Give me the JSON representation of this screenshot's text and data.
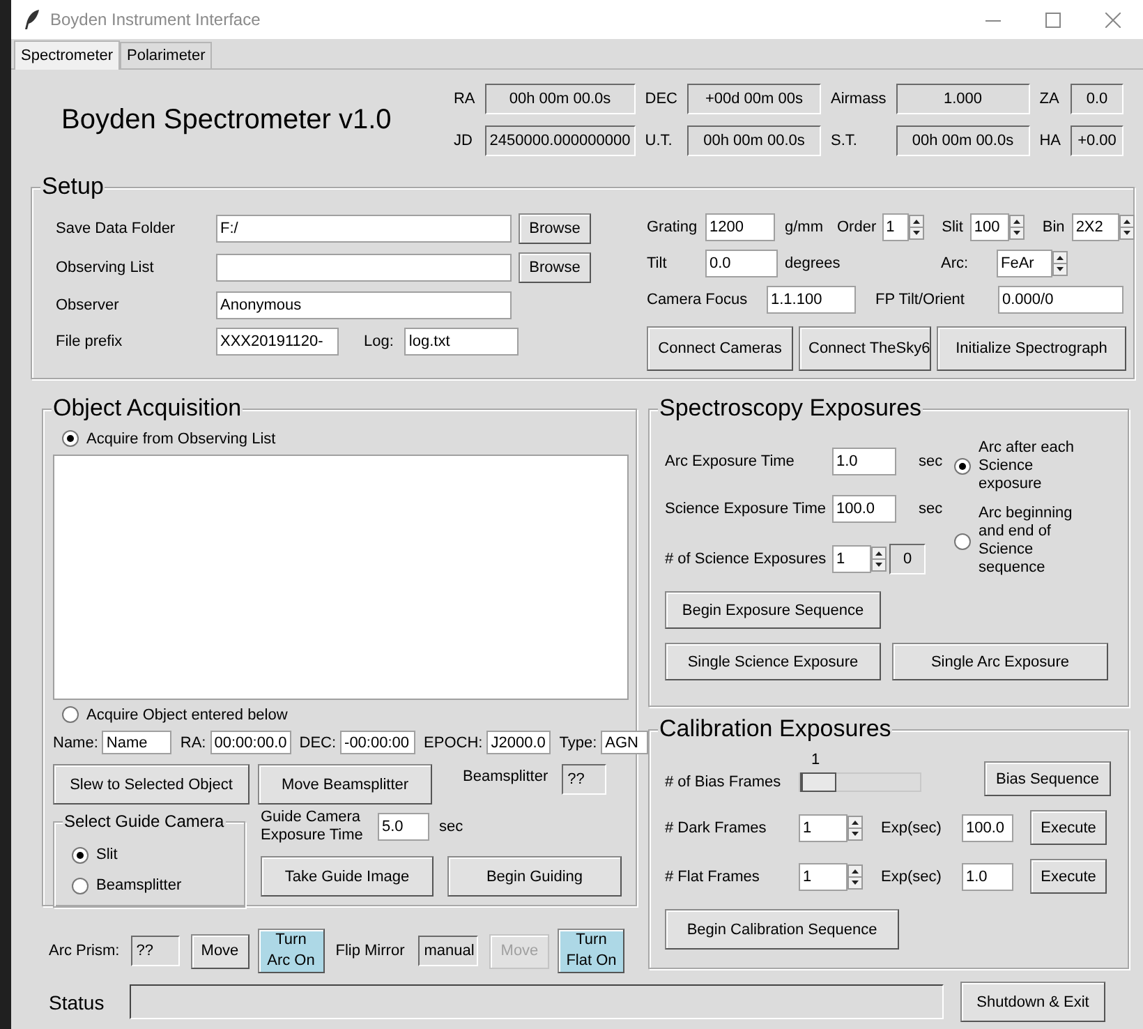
{
  "window": {
    "title": "Boyden Instrument Interface"
  },
  "tabs": [
    {
      "label": "Spectrometer",
      "selected": true
    },
    {
      "label": "Polarimeter",
      "selected": false
    }
  ],
  "header": {
    "title": "Boyden Spectrometer v1.0",
    "readouts": [
      {
        "label": "RA",
        "value": "00h 00m 00.0s"
      },
      {
        "label": "DEC",
        "value": "+00d 00m 00s"
      },
      {
        "label": "Airmass",
        "value": "1.000"
      },
      {
        "label": "ZA",
        "value": "0.0"
      },
      {
        "label": "JD",
        "value": "2450000.000000000"
      },
      {
        "label": "U.T.",
        "value": "00h 00m 00.0s"
      },
      {
        "label": "S.T.",
        "value": "00h 00m 00.0s"
      },
      {
        "label": "HA",
        "value": "+0.00"
      }
    ]
  },
  "setup": {
    "title": "Setup",
    "save_folder": {
      "label": "Save Data Folder",
      "value": "F:/",
      "button": "Browse"
    },
    "observing_list": {
      "label": "Observing List",
      "button": "Browse"
    },
    "observer": {
      "label": "Observer",
      "value": "Anonymous"
    },
    "file_prefix": {
      "label": "File prefix",
      "value": "XXX20191120-"
    },
    "log": {
      "label": "Log:",
      "value": "log.txt"
    },
    "grating": {
      "label": "Grating",
      "value": "1200",
      "unit": "g/mm"
    },
    "order": {
      "label": "Order",
      "value": "1"
    },
    "slit": {
      "label": "Slit",
      "value": "100"
    },
    "bin": {
      "label": "Bin",
      "value": "2X2"
    },
    "tilt": {
      "label": "Tilt",
      "value": "0.0",
      "unit": "degrees"
    },
    "arc": {
      "label": "Arc:",
      "value": "FeAr"
    },
    "camera_focus": {
      "label": "Camera Focus",
      "value": "1.1.100"
    },
    "fp_tilt": {
      "label": "FP Tilt/Orient",
      "value": "0.000/0"
    },
    "buttons": [
      "Connect Cameras",
      "Connect TheSky6",
      "Initialize Spectrograph"
    ]
  },
  "acquisition": {
    "title": "Object Acquisition",
    "sources": [
      {
        "label": "Acquire from Observing List",
        "selected": true
      },
      {
        "label": "Acquire Object entered below",
        "selected": false
      }
    ],
    "object_fields": [
      {
        "label": "Name:",
        "value": "Name"
      },
      {
        "label": "RA:",
        "value": "00:00:00.0"
      },
      {
        "label": "DEC:",
        "value": "-00:00:00"
      },
      {
        "label": "EPOCH:",
        "value": "J2000.0"
      },
      {
        "label": "Type:",
        "value": "AGN"
      }
    ],
    "slew_button": "Slew to Selected Object",
    "beamsplitter_button": "Move Beamsplitter",
    "beamsplitter": {
      "label": "Beamsplitter",
      "value": "??"
    },
    "guide_camera": {
      "title": "Select Guide Camera",
      "options": [
        {
          "label": "Slit",
          "selected": true
        },
        {
          "label": "Beamsplitter",
          "selected": false
        }
      ]
    },
    "guide_exposure": {
      "label": "Guide Camera Exposure Time",
      "value": "5.0",
      "unit": "sec"
    },
    "guide_buttons": [
      "Take Guide Image",
      "Begin Guiding"
    ]
  },
  "lamps": {
    "arc_prism": {
      "label": "Arc Prism:",
      "value": "??",
      "button": "Move",
      "disabled": false
    },
    "arc_button": "Turn Arc On",
    "flip_mirror": {
      "label": "Flip Mirror",
      "value": "manual",
      "button": "Move",
      "disabled": true
    },
    "flat_button": "Turn Flat On"
  },
  "spectroscopy": {
    "title": "Spectroscopy Exposures",
    "arc_time": {
      "label": "Arc Exposure Time",
      "value": "1.0",
      "unit": "sec"
    },
    "science_time": {
      "label": "Science Exposure Time",
      "value": "100.0",
      "unit": "sec"
    },
    "count": {
      "label": "# of Science Exposures",
      "value": "1",
      "done": "0"
    },
    "arc_modes": [
      {
        "label": "Arc after each Science exposure",
        "selected": true
      },
      {
        "label": "Arc beginning and end of Science sequence",
        "selected": false
      }
    ],
    "buttons": [
      "Begin Exposure Sequence",
      "Single Science Exposure",
      "Single Arc Exposure"
    ]
  },
  "calibration": {
    "title": "Calibration Exposures",
    "bias": {
      "label": "# of Bias Frames",
      "reading": "1",
      "level": 0,
      "button": "Bias Sequence"
    },
    "frames": [
      {
        "label": "# Dark Frames",
        "count": "1",
        "exp_label": "Exp(sec)",
        "exp": "100.0",
        "button": "Execute"
      },
      {
        "label": "# Flat Frames",
        "count": "1",
        "exp_label": "Exp(sec)",
        "exp": "1.0",
        "button": "Execute"
      }
    ],
    "button": "Begin Calibration Sequence"
  },
  "status": {
    "label": "Status",
    "button": "Shutdown & Exit"
  }
}
